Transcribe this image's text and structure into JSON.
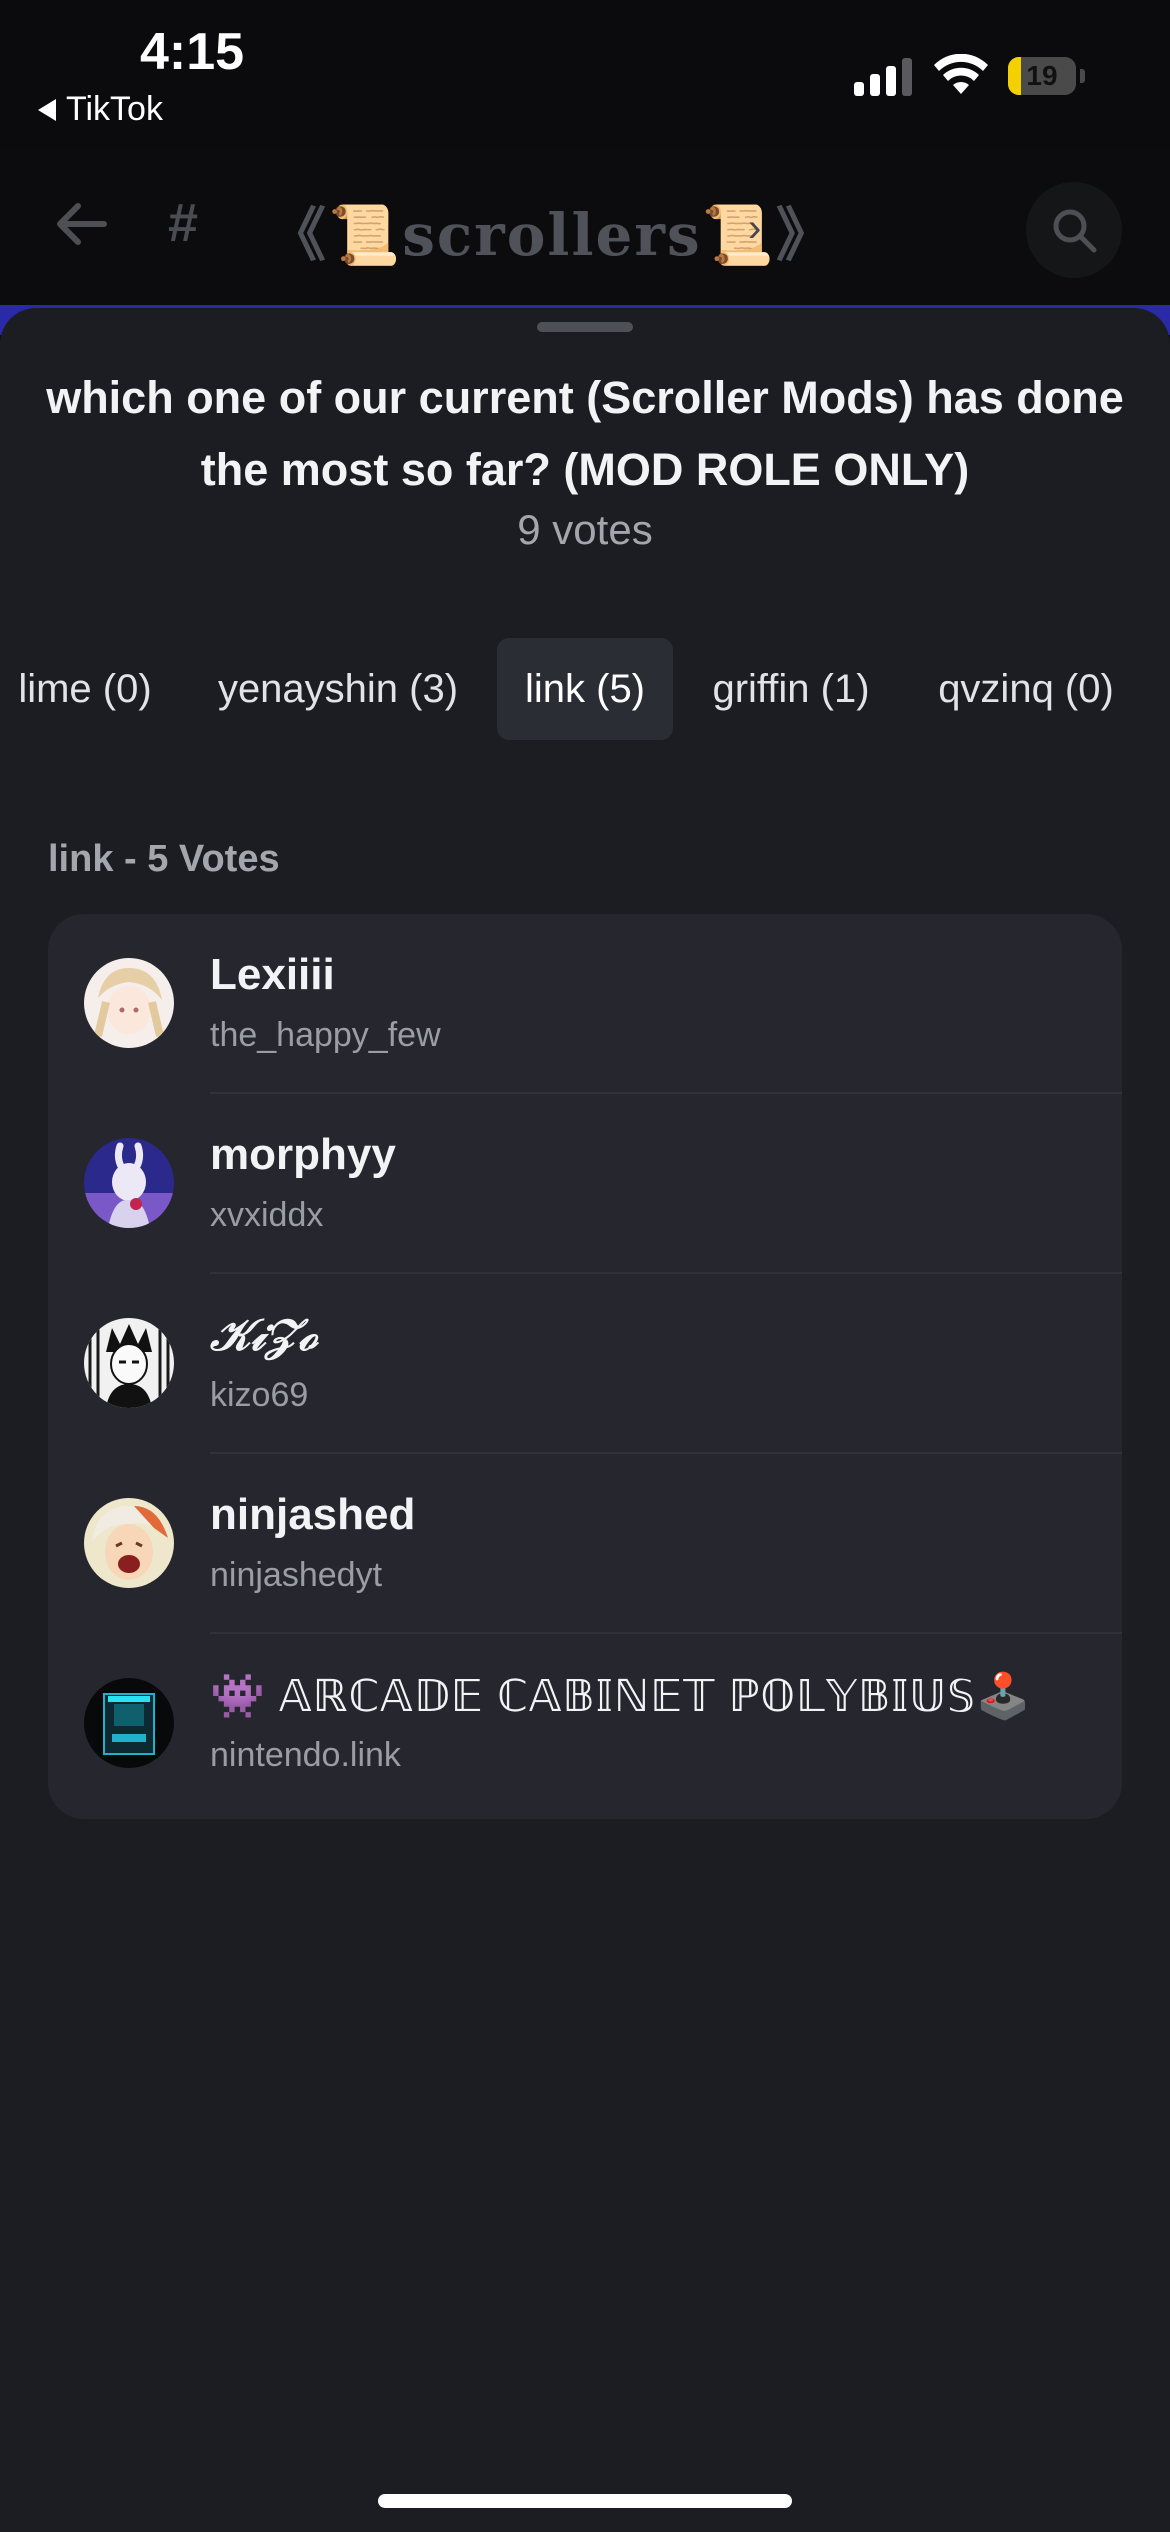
{
  "status_bar": {
    "time": "4:15",
    "back_app": "TikTok",
    "battery": "19",
    "battery_level": 0.19,
    "signal_bars": 3
  },
  "channel_header": {
    "hash": "#",
    "channel_name": "《📜scrollers📜》",
    "chevron": "›"
  },
  "poll": {
    "question": "which one of our current (Scroller Mods) has done the most so far? (MOD ROLE ONLY)",
    "total_votes": "9 votes",
    "tabs": [
      {
        "label": "lime (0)"
      },
      {
        "label": "yenayshin (3)"
      },
      {
        "label": "link (5)",
        "active": true
      },
      {
        "label": "griffin (1)"
      },
      {
        "label": "qvzinq (0)"
      }
    ],
    "selected_label": "link - 5 Votes",
    "voters": [
      {
        "name": "Lexiiii",
        "username": "the_happy_few"
      },
      {
        "name": "morphyy",
        "username": "xvxiddx"
      },
      {
        "name": "𝒦𝒾𝒵ℴ",
        "username": "kizo69"
      },
      {
        "name": "ninjashed",
        "username": "ninjashedyt"
      },
      {
        "name": "👾 𝔸ℝℂ𝔸𝔻𝔼 ℂ𝔸𝔹𝕀ℕ𝔼𝕋 ℙ𝕆𝕃𝕐𝔹𝕀𝕌𝕊🕹️",
        "username": "nintendo.link"
      }
    ]
  },
  "colors": {
    "sheet_bg": "#1c1d22",
    "card_bg": "#26272e",
    "active_tab_bg": "#2b2d34",
    "muted_text": "#a3a6ad",
    "accent_strip": "#2a2aa8"
  }
}
